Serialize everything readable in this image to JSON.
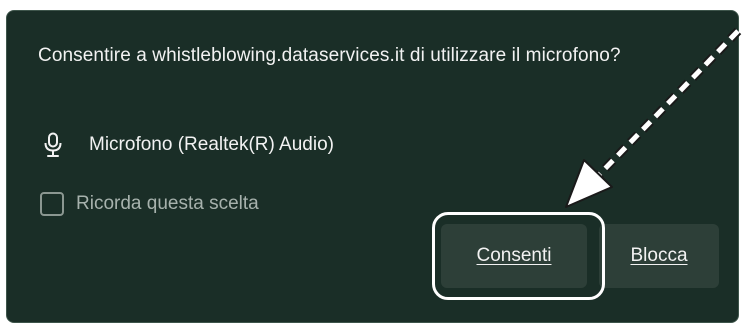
{
  "dialog": {
    "question": "Consentire a whistleblowing.dataservices.it di utilizzare il microfono?",
    "device_icon": "microphone-icon",
    "device_label": "Microfono (Realtek(R) Audio)",
    "remember_checked": false,
    "remember_label": "Ricorda questa scelta",
    "allow_label": "Consenti",
    "block_label": "Blocca"
  },
  "annotation": {
    "arrow_icon": "dashed-arrow-icon",
    "highlight": "rounded-highlight-outline",
    "color": "#ffffff"
  },
  "colors": {
    "dialog_background": "#1a2e27",
    "button_background": "#2d3f38",
    "text": "#f2f2f2",
    "muted_text": "#a7b2ad"
  }
}
